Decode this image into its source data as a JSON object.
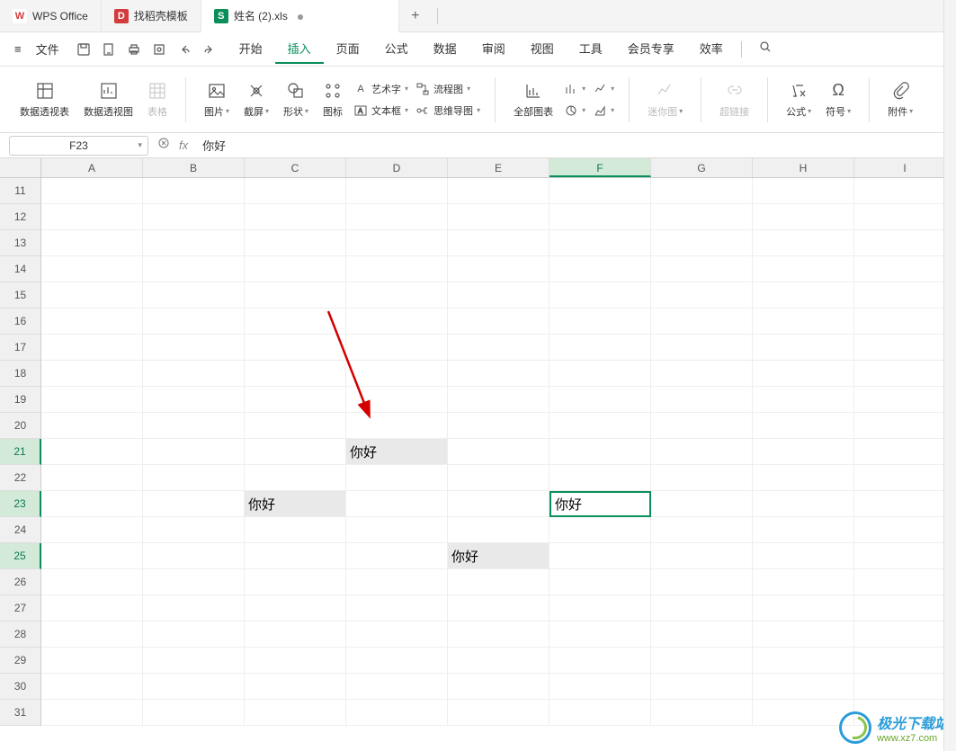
{
  "titlebar": {
    "app_name": "WPS Office",
    "tabs": [
      {
        "icon_letter": "D",
        "icon_bg": "#d23c3c",
        "label": "找稻壳模板"
      },
      {
        "icon_letter": "S",
        "icon_bg": "#0a8f5b",
        "label": "姓名 (2).xls",
        "active": true
      }
    ],
    "add": "+"
  },
  "menubar": {
    "file": "文件",
    "items": [
      "开始",
      "插入",
      "页面",
      "公式",
      "数据",
      "审阅",
      "视图",
      "工具",
      "会员专享",
      "效率"
    ],
    "active_index": 1
  },
  "ribbon": {
    "pivot_table": "数据透视表",
    "pivot_chart": "数据透视图",
    "table": "表格",
    "picture": "图片",
    "screenshot": "截屏",
    "shape": "形状",
    "icon": "图标",
    "wordart": "艺术字",
    "textbox": "文本框",
    "flowchart": "流程图",
    "mindmap": "思维导图",
    "all_charts": "全部图表",
    "sparkline": "迷你图",
    "hyperlink": "超链接",
    "formula": "公式",
    "symbol": "符号",
    "attachment": "附件"
  },
  "formulabar": {
    "cellref": "F23",
    "value": "你好"
  },
  "grid": {
    "columns": [
      "A",
      "B",
      "C",
      "D",
      "E",
      "F",
      "G",
      "H",
      "I"
    ],
    "first_row": 11,
    "last_row": 31,
    "selected_col": "F",
    "selected_row": 23,
    "cells": {
      "D21": "你好",
      "C23": "你好",
      "F23": "你好",
      "E25": "你好"
    },
    "highlighted": [
      "D21",
      "C23",
      "E25"
    ],
    "row_highlight": [
      21,
      23,
      25
    ]
  },
  "watermark": {
    "text1": "极光下载站",
    "text2": "www.xz7.com"
  }
}
